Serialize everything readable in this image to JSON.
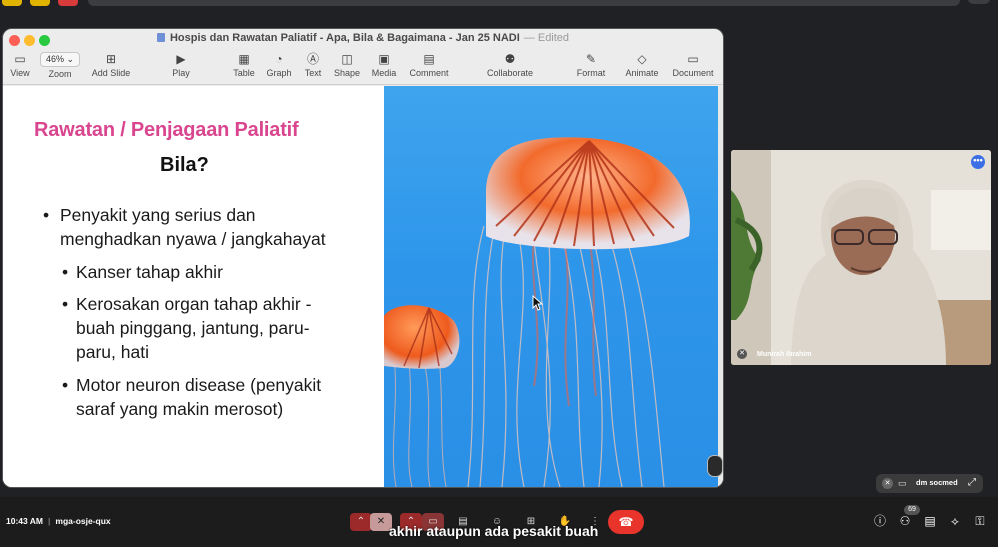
{
  "window": {
    "title": "Hospis dan Rawatan Paliatif - Apa, Bila & Bagaimana - Jan 25 NADI",
    "edited": "— Edited"
  },
  "toolbar": {
    "zoom_value": "46% ⌄",
    "view": "View",
    "zoom": "Zoom",
    "add_slide": "Add Slide",
    "play": "Play",
    "table": "Table",
    "graph": "Graph",
    "text": "Text",
    "shape": "Shape",
    "media": "Media",
    "comment": "Comment",
    "collaborate": "Collaborate",
    "format": "Format",
    "animate": "Animate",
    "document": "Document"
  },
  "slide": {
    "title": "Rawatan / Penjagaan Paliatif",
    "subtitle": "Bila?",
    "bullet1": "Penyakit yang serius dan menghadkan nyawa / jangkahayat",
    "sub1": "Kanser tahap akhir",
    "sub2": "Kerosakan organ tahap akhir - buah pinggang, jantung, paru-paru, hati",
    "sub3": "Motor neuron disease (penyakit saraf yang makin merosot)"
  },
  "participant": {
    "name": "Munirah Ibrahim"
  },
  "mini_view": {
    "label": "dm socmed"
  },
  "meeting": {
    "time": "10:43 AM",
    "code": "mga-osje-qux",
    "participants_count": "69",
    "caption": "akhir ataupun ada pesakit buah"
  },
  "colors": {
    "accent_title": "#d9468f",
    "end_call": "#e8342b",
    "background": "#202124"
  }
}
